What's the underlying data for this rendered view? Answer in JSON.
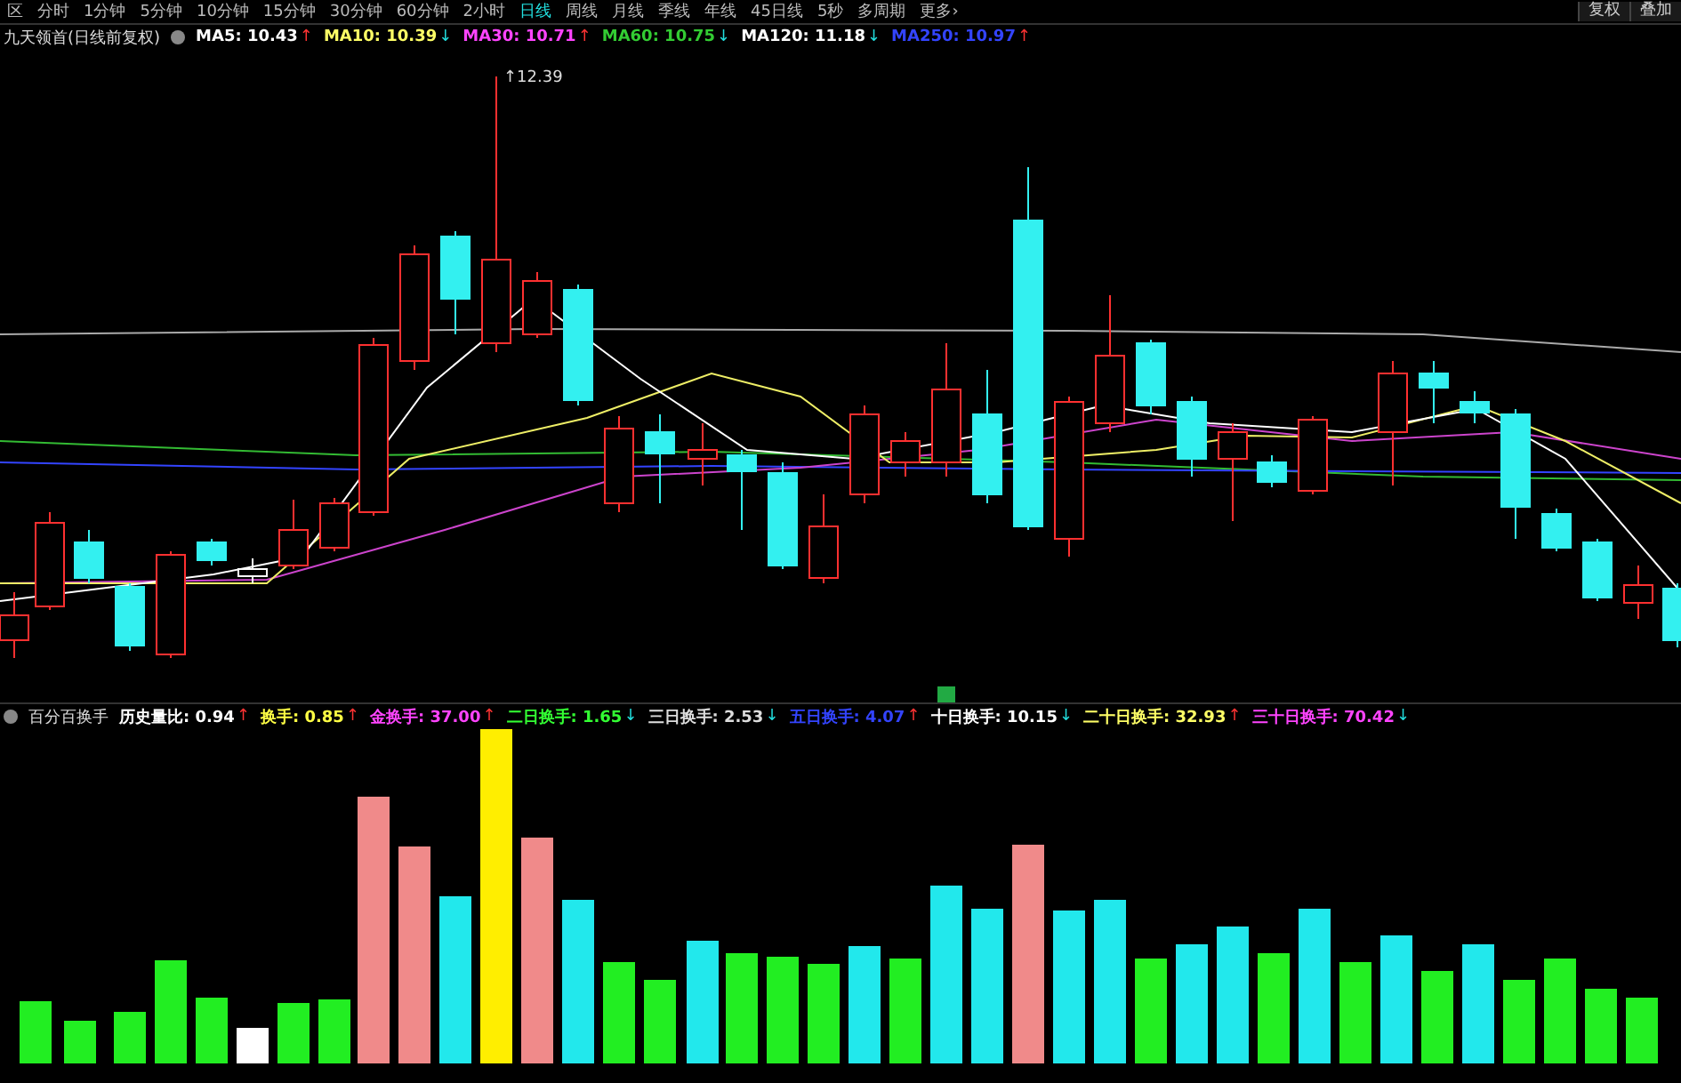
{
  "toolbar": {
    "periods": [
      {
        "label": "区",
        "selected": false
      },
      {
        "label": "分时",
        "selected": false
      },
      {
        "label": "1分钟",
        "selected": false
      },
      {
        "label": "5分钟",
        "selected": false
      },
      {
        "label": "10分钟",
        "selected": false
      },
      {
        "label": "15分钟",
        "selected": false
      },
      {
        "label": "30分钟",
        "selected": false
      },
      {
        "label": "60分钟",
        "selected": false
      },
      {
        "label": "2小时",
        "selected": false
      },
      {
        "label": "日线",
        "selected": true
      },
      {
        "label": "周线",
        "selected": false
      },
      {
        "label": "月线",
        "selected": false
      },
      {
        "label": "季线",
        "selected": false
      },
      {
        "label": "年线",
        "selected": false
      },
      {
        "label": "45日线",
        "selected": false
      },
      {
        "label": "5秒",
        "selected": false
      },
      {
        "label": "多周期",
        "selected": false
      },
      {
        "label": "更多›",
        "selected": false
      }
    ],
    "actions": [
      "复权",
      "叠加"
    ]
  },
  "main_chart": {
    "title": "九天领首(日线前复权)",
    "indicators": [
      {
        "label": "MA5: 10.43",
        "color": "#ffffff",
        "arrow": "↑",
        "rising": true
      },
      {
        "label": "MA10: 10.39",
        "color": "#ffff66",
        "arrow": "↓",
        "rising": false
      },
      {
        "label": "MA30: 10.71",
        "color": "#ff44ff",
        "arrow": "↑",
        "rising": true
      },
      {
        "label": "MA60: 10.75",
        "color": "#33cc33",
        "arrow": "↓",
        "rising": false
      },
      {
        "label": "MA120: 11.18",
        "color": "#ffffff",
        "arrow": "↓",
        "rising": false
      },
      {
        "label": "MA250: 10.97",
        "color": "#3344ff",
        "arrow": "↑",
        "rising": true
      }
    ],
    "high_label": "↑12.39"
  },
  "sub_chart": {
    "title": "百分百换手",
    "indicators": [
      {
        "label": "历史量比: 0.94",
        "color": "#ffffff",
        "arrow": "↑",
        "rising": true
      },
      {
        "label": "换手: 0.85",
        "color": "#ffff44",
        "arrow": "↑",
        "rising": true
      },
      {
        "label": "金换手: 37.00",
        "color": "#ff44ff",
        "arrow": "↑",
        "rising": true
      },
      {
        "label": "二日换手: 1.65",
        "color": "#33ff33",
        "arrow": "↓",
        "rising": false
      },
      {
        "label": "三日换手: 2.53",
        "color": "#dddddd",
        "arrow": "↓",
        "rising": false
      },
      {
        "label": "五日换手: 4.07",
        "color": "#3344ff",
        "arrow": "↑",
        "rising": true
      },
      {
        "label": "十日换手: 10.15",
        "color": "#ffffff",
        "arrow": "↓",
        "rising": false
      },
      {
        "label": "二十日换手: 32.93",
        "color": "#ffff66",
        "arrow": "↑",
        "rising": true
      },
      {
        "label": "三十日换手: 70.42",
        "color": "#ff44ff",
        "arrow": "↓",
        "rising": false
      }
    ]
  }
}
